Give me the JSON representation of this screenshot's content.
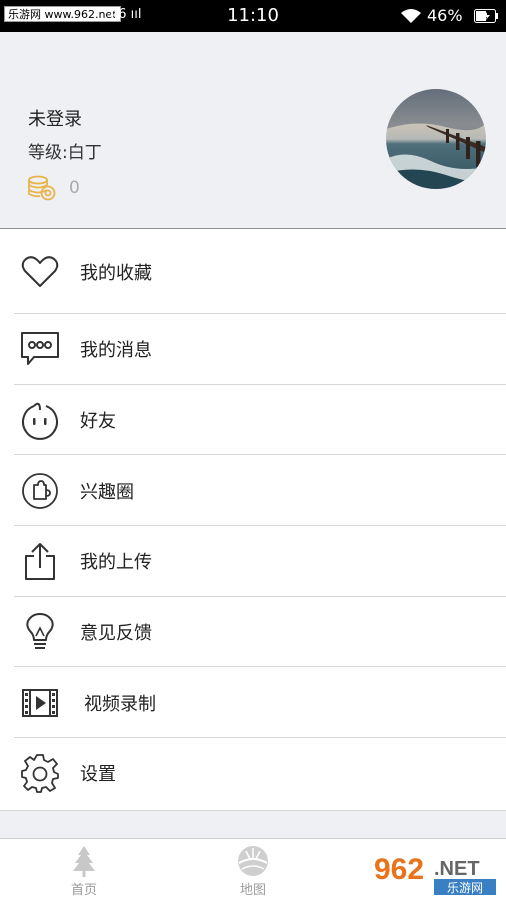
{
  "status_bar": {
    "watermark": "乐游网 www.962.net",
    "carrier": "46 ııl",
    "time": "11:10",
    "battery": "46%"
  },
  "profile": {
    "name": "未登录",
    "level": "等级:白丁",
    "coins": "0"
  },
  "menu": {
    "items": [
      {
        "label": "我的收藏",
        "icon": "heart-icon"
      },
      {
        "label": "我的消息",
        "icon": "message-icon"
      },
      {
        "label": "好友",
        "icon": "friend-face-icon"
      },
      {
        "label": "兴趣圈",
        "icon": "puzzle-circle-icon"
      },
      {
        "label": "我的上传",
        "icon": "upload-icon"
      },
      {
        "label": "意见反馈",
        "icon": "lightbulb-icon"
      },
      {
        "label": "视频录制",
        "icon": "film-icon"
      },
      {
        "label": "设置",
        "icon": "gear-icon"
      }
    ]
  },
  "tabbar": {
    "tabs": [
      {
        "label": "首页",
        "icon": "tree-icon"
      },
      {
        "label": "地图",
        "icon": "globe-icon"
      }
    ]
  },
  "watermark_badge": {
    "brand": "962",
    "suffix": ".NET",
    "caption": "乐游网"
  },
  "colors": {
    "header_bg": "#eff0f4",
    "coin_gold": "#e8b44a",
    "text": "#222222",
    "muted": "#9a9a9a"
  }
}
